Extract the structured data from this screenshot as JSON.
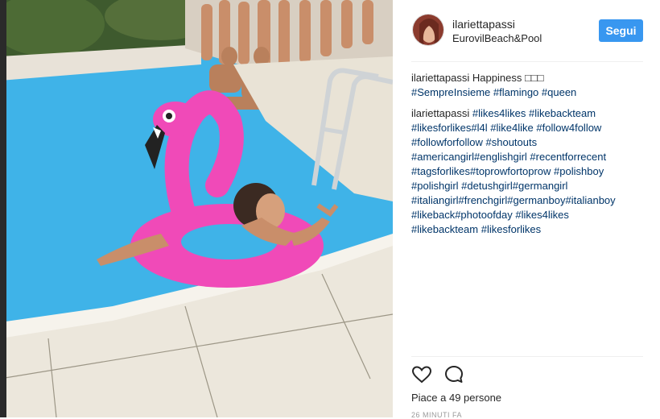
{
  "post": {
    "username": "ilariettapassi",
    "location": "EurovilBeach&Pool",
    "follow_label": "Segui"
  },
  "comments": [
    {
      "user": "ilariettapassi",
      "text": "Happiness ",
      "emoji": "□□□",
      "tags": [
        "#SempreInsieme",
        "#flamingo",
        "#queen"
      ]
    },
    {
      "user": "ilariettapassi",
      "tags": [
        "#likes4likes",
        "#likebackteam",
        "#likesforlikes#l4l",
        "#like4like",
        "#follow4follow",
        "#followforfollow",
        "#shoutouts",
        "#americangirl#englishgirl",
        "#recentforrecent",
        "#tagsforlikes#toprowfortoprow",
        "#polishboy",
        "#polishgirl",
        "#detushgirl#germangirl",
        "#italiangirl#frenchgirl#germanboy#italianboy",
        "#likeback#photoofday",
        "#likes4likes",
        "#likebackteam",
        "#likesforlikes"
      ]
    }
  ],
  "actions": {
    "like_icon": "heart-icon",
    "comment_icon": "speech-bubble-icon"
  },
  "likes_text": "Piace a 49 persone",
  "timestamp": "26 MINUTI FA",
  "colors": {
    "accent": "#3897f0",
    "hashtag": "#003569",
    "pool": "#3fb3e8",
    "flamingo": "#f04ab8"
  }
}
